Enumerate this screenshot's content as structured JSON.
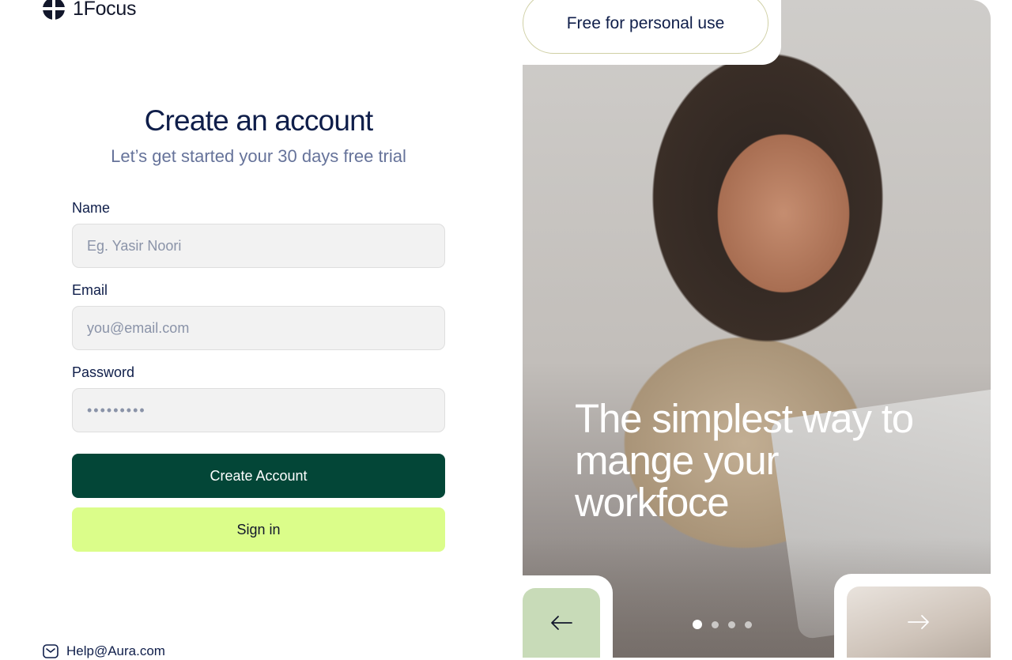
{
  "brand": {
    "name": "1Focus"
  },
  "form": {
    "title": "Create an account",
    "subtitle": "Let’s get started your 30 days free trial",
    "fields": [
      {
        "label": "Name",
        "placeholder": "Eg. Yasir Noori",
        "value": ""
      },
      {
        "label": "Email",
        "placeholder": "you@email.com",
        "value": ""
      },
      {
        "label": "Password",
        "placeholder": "",
        "value": "•••••••••"
      }
    ],
    "create_button": "Create Account",
    "signin_button": "Sign in"
  },
  "footer": {
    "help_email": "Help@Aura.com",
    "icon": "mail-icon"
  },
  "hero": {
    "badge": "Free for personal use",
    "headline": "The simplest way to mange your workfoce",
    "carousel": {
      "slides": 4,
      "active_index": 0
    },
    "prev_icon": "arrow-left-icon",
    "next_icon": "arrow-right-icon"
  },
  "colors": {
    "primary": "#034637",
    "accent": "#dbfd8a",
    "heading": "#0f1e4a",
    "muted": "#66739a",
    "prev_button_bg": "#c8dbb8"
  }
}
